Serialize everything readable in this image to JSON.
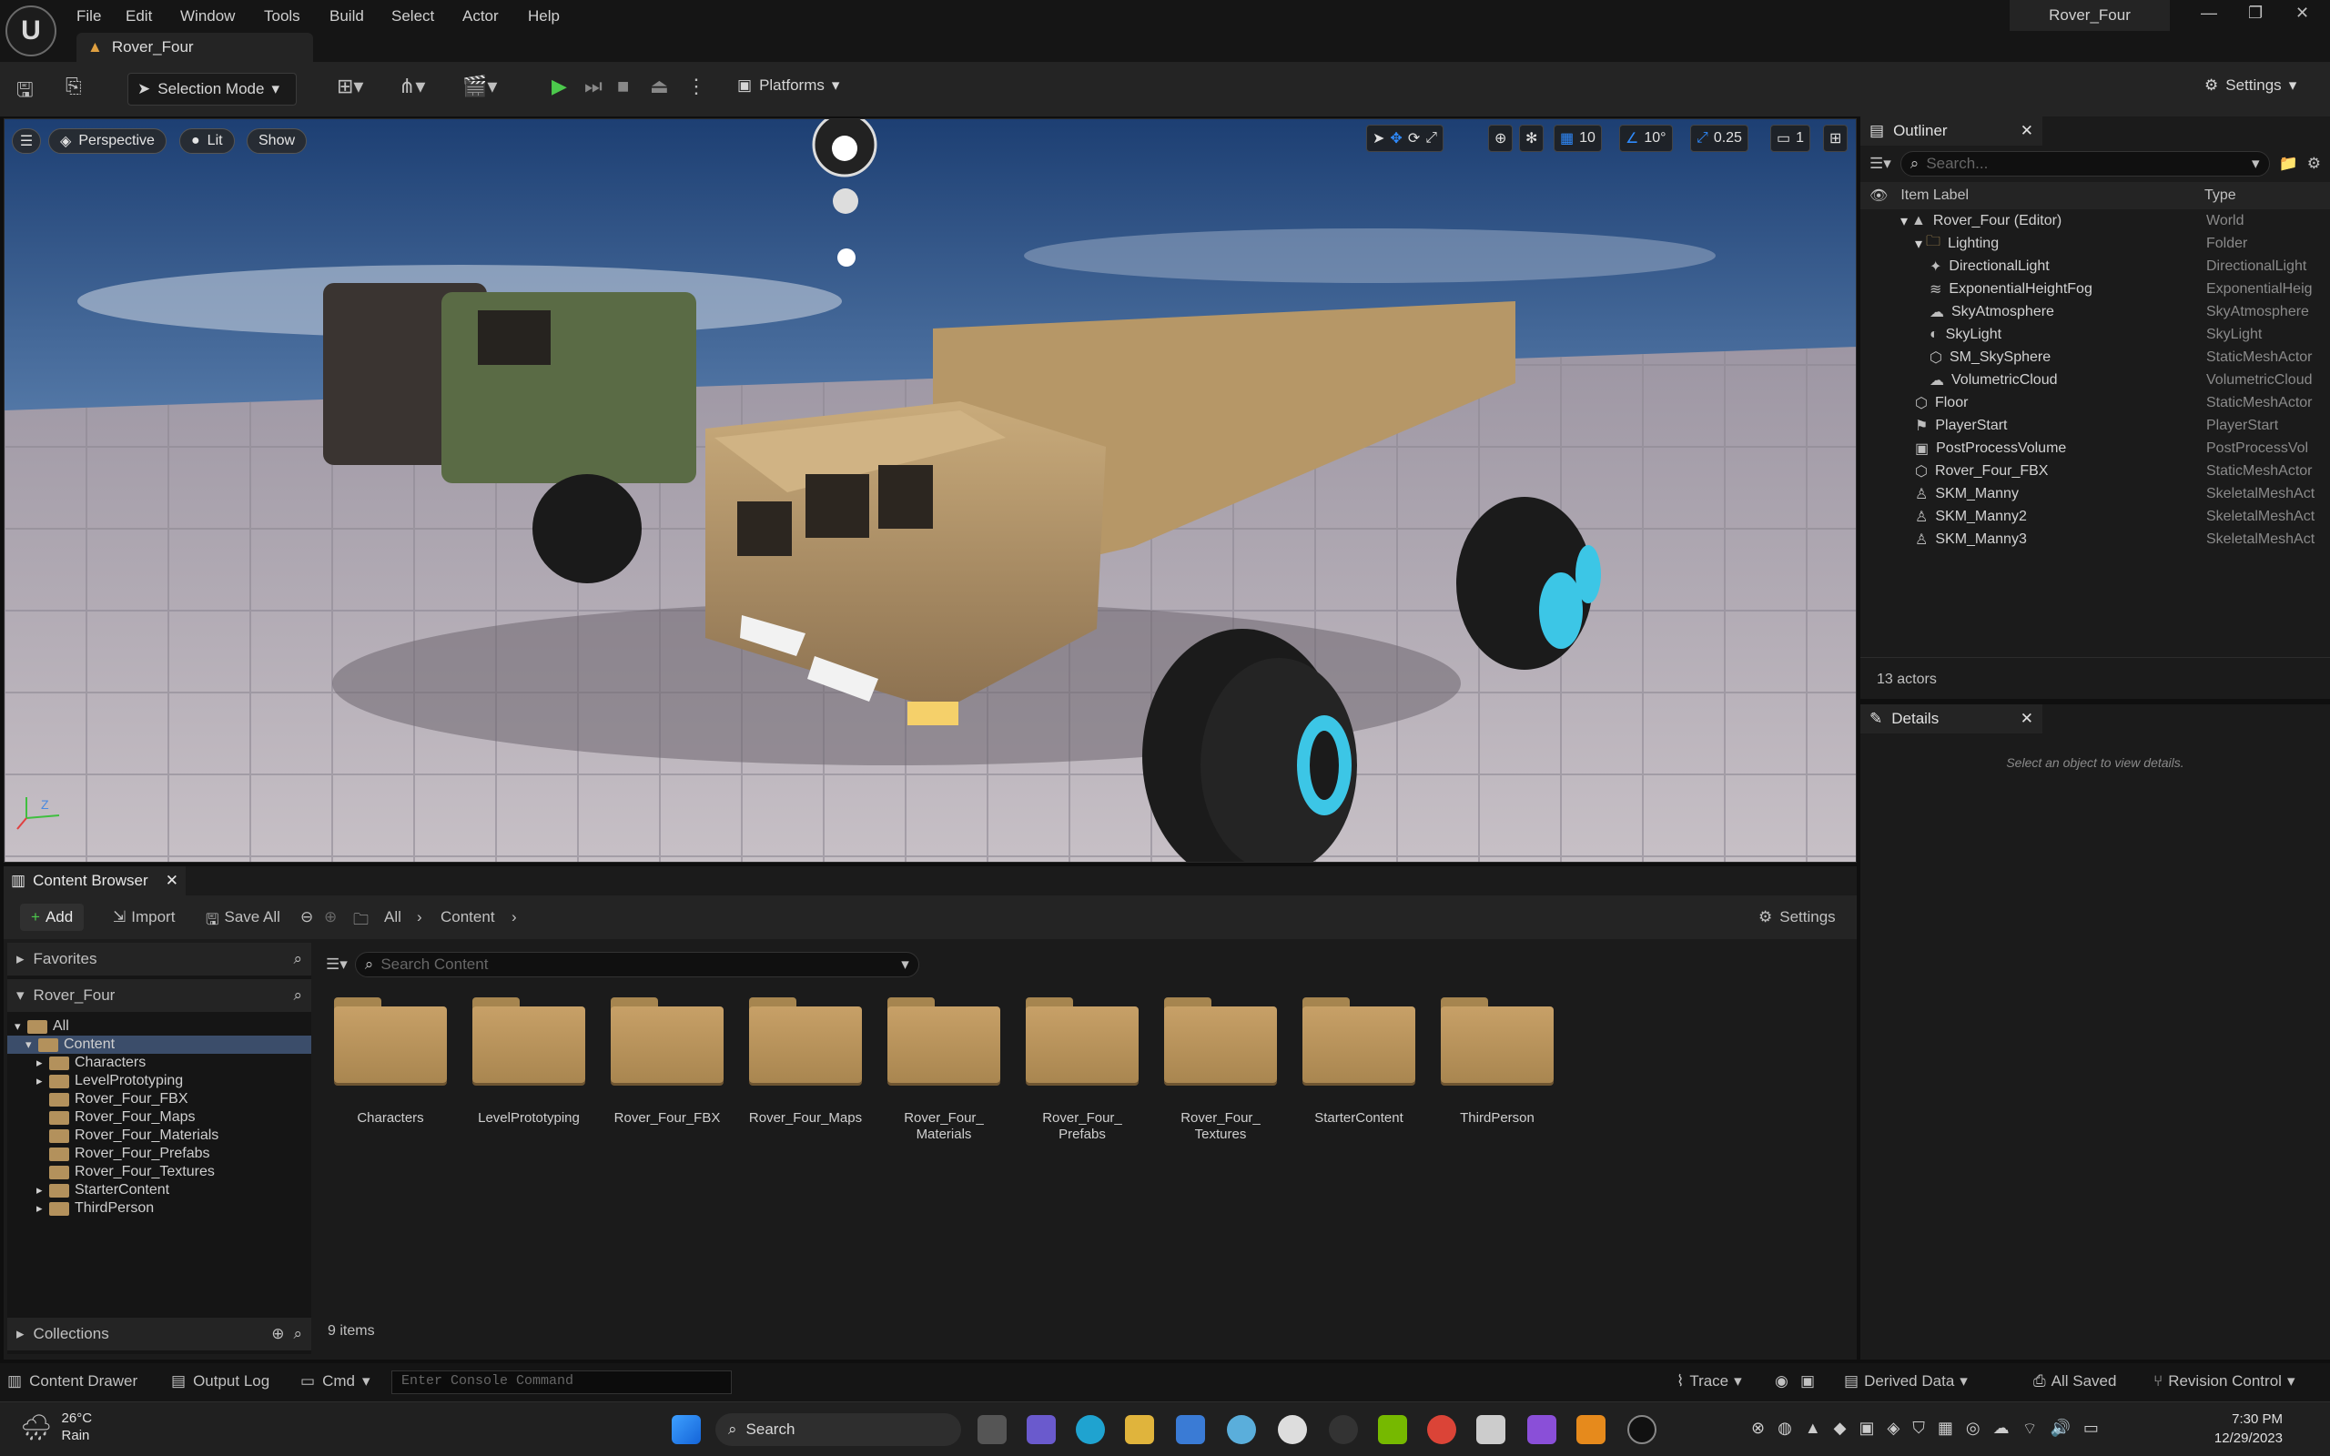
{
  "window": {
    "title": "Rover_Four",
    "level_tab": "Rover_Four"
  },
  "menu": [
    "File",
    "Edit",
    "Window",
    "Tools",
    "Build",
    "Select",
    "Actor",
    "Help"
  ],
  "toolbar": {
    "mode": "Selection Mode",
    "platforms": "Platforms",
    "settings": "Settings"
  },
  "viewport": {
    "view_mode": "Perspective",
    "lighting": "Lit",
    "show": "Show",
    "grid_snap": "10",
    "rotation_snap": "10°",
    "scale_snap": "0.25",
    "camera_speed": "1"
  },
  "outliner": {
    "tab": "Outliner",
    "search_placeholder": "Search...",
    "col_label": "Item Label",
    "col_type": "Type",
    "rows": [
      {
        "label": "Rover_Four (Editor)",
        "type": "World",
        "indent": 0,
        "icon": "world"
      },
      {
        "label": "Lighting",
        "type": "Folder",
        "indent": 1,
        "icon": "folder"
      },
      {
        "label": "DirectionalLight",
        "type": "DirectionalLight",
        "indent": 2,
        "icon": "light"
      },
      {
        "label": "ExponentialHeightFog",
        "type": "ExponentialHeig",
        "indent": 2,
        "icon": "fog"
      },
      {
        "label": "SkyAtmosphere",
        "type": "SkyAtmosphere",
        "indent": 2,
        "icon": "sky"
      },
      {
        "label": "SkyLight",
        "type": "SkyLight",
        "indent": 2,
        "icon": "skylight"
      },
      {
        "label": "SM_SkySphere",
        "type": "StaticMeshActor",
        "indent": 2,
        "icon": "mesh"
      },
      {
        "label": "VolumetricCloud",
        "type": "VolumetricCloud",
        "indent": 2,
        "icon": "cloud"
      },
      {
        "label": "Floor",
        "type": "StaticMeshActor",
        "indent": 1,
        "icon": "mesh"
      },
      {
        "label": "PlayerStart",
        "type": "PlayerStart",
        "indent": 1,
        "icon": "flag"
      },
      {
        "label": "PostProcessVolume",
        "type": "PostProcessVol",
        "indent": 1,
        "icon": "volume"
      },
      {
        "label": "Rover_Four_FBX",
        "type": "StaticMeshActor",
        "indent": 1,
        "icon": "mesh"
      },
      {
        "label": "SKM_Manny",
        "type": "SkeletalMeshAct",
        "indent": 1,
        "icon": "person"
      },
      {
        "label": "SKM_Manny2",
        "type": "SkeletalMeshAct",
        "indent": 1,
        "icon": "person"
      },
      {
        "label": "SKM_Manny3",
        "type": "SkeletalMeshAct",
        "indent": 1,
        "icon": "person"
      }
    ],
    "actor_count": "13 actors"
  },
  "details": {
    "tab": "Details",
    "empty_text": "Select an object to view details."
  },
  "content_browser": {
    "tab": "Content Browser",
    "add": "Add",
    "import": "Import",
    "save_all": "Save All",
    "path": [
      "All",
      "Content"
    ],
    "settings": "Settings",
    "favorites": "Favorites",
    "project": "Rover_Four",
    "search_placeholder": "Search Content",
    "tree": [
      {
        "label": "All",
        "indent": 0,
        "expanded": true,
        "selected": false
      },
      {
        "label": "Content",
        "indent": 1,
        "expanded": true,
        "selected": true
      },
      {
        "label": "Characters",
        "indent": 2,
        "expanded": false,
        "selected": false,
        "arrow": true
      },
      {
        "label": "LevelPrototyping",
        "indent": 2,
        "expanded": false,
        "selected": false,
        "arrow": true
      },
      {
        "label": "Rover_Four_FBX",
        "indent": 2,
        "selected": false
      },
      {
        "label": "Rover_Four_Maps",
        "indent": 2,
        "selected": false
      },
      {
        "label": "Rover_Four_Materials",
        "indent": 2,
        "selected": false
      },
      {
        "label": "Rover_Four_Prefabs",
        "indent": 2,
        "selected": false
      },
      {
        "label": "Rover_Four_Textures",
        "indent": 2,
        "selected": false
      },
      {
        "label": "StarterContent",
        "indent": 2,
        "selected": false,
        "arrow": true
      },
      {
        "label": "ThirdPerson",
        "indent": 2,
        "selected": false,
        "arrow": true
      }
    ],
    "assets": [
      [
        "Characters"
      ],
      [
        "LevelPrototyping"
      ],
      [
        "Rover_Four_FBX"
      ],
      [
        "Rover_Four_Maps"
      ],
      [
        "Rover_Four_",
        "Materials"
      ],
      [
        "Rover_Four_",
        "Prefabs"
      ],
      [
        "Rover_Four_",
        "Textures"
      ],
      [
        "StarterContent"
      ],
      [
        "ThirdPerson"
      ]
    ],
    "item_count": "9 items",
    "collections": "Collections"
  },
  "statusbar": {
    "content_drawer": "Content Drawer",
    "output_log": "Output Log",
    "cmd": "Cmd",
    "console_placeholder": "Enter Console Command",
    "trace": "Trace",
    "derived_data": "Derived Data",
    "all_saved": "All Saved",
    "revision_control": "Revision Control"
  },
  "taskbar": {
    "weather_temp": "26°C",
    "weather_desc": "Rain",
    "search": "Search",
    "time": "7:30 PM",
    "date": "12/29/2023"
  }
}
